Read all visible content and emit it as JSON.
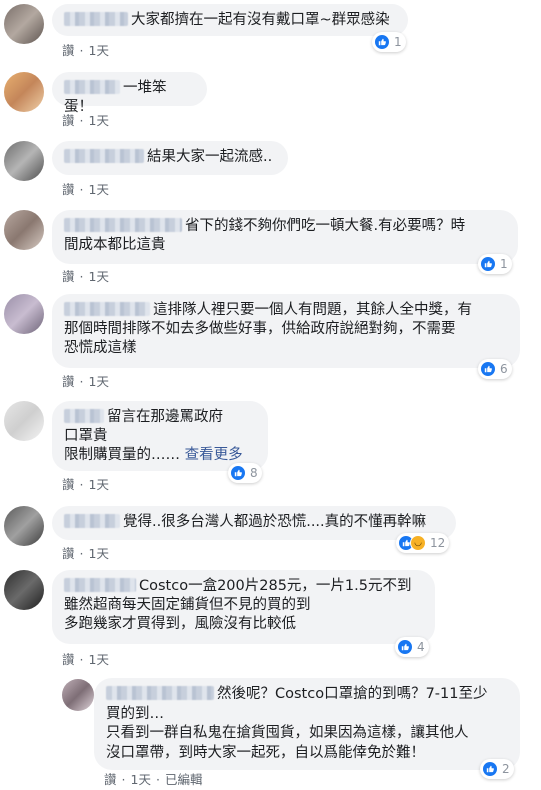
{
  "comments": [
    {
      "text": "大家都擠在一起有沒有戴口罩~群眾感染",
      "like_label": "讚",
      "time": "1天",
      "reactions": "1"
    },
    {
      "text": "一堆笨蛋！",
      "like_label": "讚",
      "time": "1天"
    },
    {
      "text": "結果大家一起流感..",
      "like_label": "讚",
      "time": "1天"
    },
    {
      "line1": "省下的錢不夠你們吃一頓大餐.有必要嗎？時",
      "line2": "間成本都比這貴",
      "like_label": "讚",
      "time": "1天",
      "reactions": "1"
    },
    {
      "line1": "這排隊人裡只要一個人有問題，其餘人全中獎，有",
      "line2": "那個時間排隊不如去多做些好事，供給政府說絕對夠，不需要",
      "line3": "恐慌成這樣",
      "like_label": "讚",
      "time": "1天",
      "reactions": "6"
    },
    {
      "line1": "留言在那邊罵政府",
      "line2": "口罩貴",
      "line3": "限制購買量的……",
      "see_more": "查看更多",
      "like_label": "讚",
      "time": "1天",
      "reactions": "8"
    },
    {
      "text": "覺得..很多台灣人都過於恐慌....真的不懂再幹嘛",
      "like_label": "讚",
      "time": "1天",
      "reactions": "12"
    },
    {
      "line1": "Costco一盒200片285元，一片1.5元不到",
      "line2": "雖然超商每天固定鋪貨但不見的買的到",
      "line3": "多跑幾家才買得到，風險沒有比較低",
      "like_label": "讚",
      "time": "1天",
      "reactions": "4"
    }
  ],
  "reply": {
    "line1": "然後呢？Costco口罩搶的到嗎？7-11至少",
    "line2": "買的到…",
    "line3": "只看到一群自私鬼在搶貨囤貨，如果因為這樣，讓其他人",
    "line4": "沒口罩帶，到時大家一起死，自以爲能倖免於難！",
    "like_label": "讚",
    "time": "1天",
    "edited": "已編輯",
    "reactions": "2"
  },
  "colors": {
    "like_blue": "#1877f2",
    "bubble_bg": "#f2f3f5",
    "meta_gray": "#606770",
    "see_more": "#385898"
  }
}
